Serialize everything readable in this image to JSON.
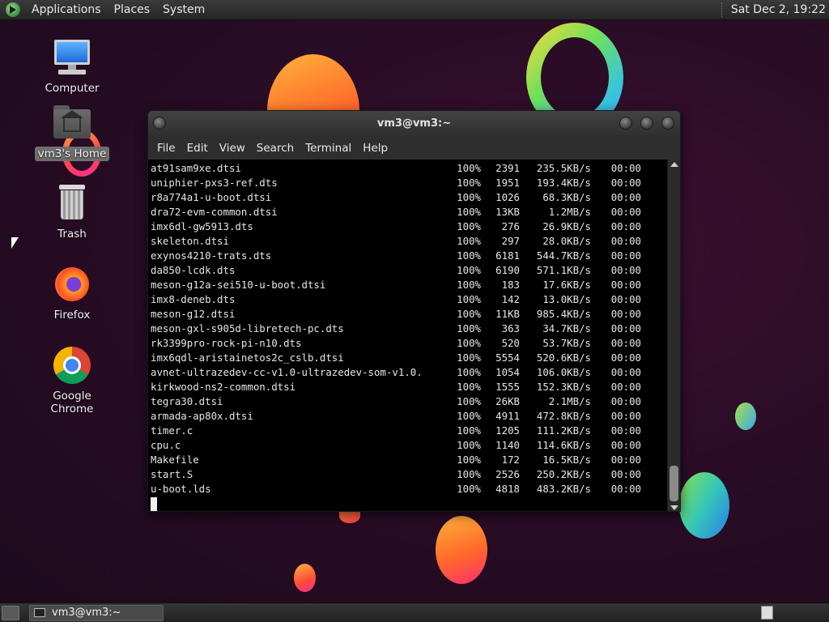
{
  "top_panel": {
    "menus": [
      "Applications",
      "Places",
      "System"
    ],
    "clock": "Sat Dec  2, 19:22"
  },
  "desktop": {
    "icons": [
      {
        "label": "Computer",
        "icon": "computer-icon"
      },
      {
        "label": "vm3's Home",
        "icon": "home-folder-icon"
      },
      {
        "label": "Trash",
        "icon": "trash-icon"
      },
      {
        "label": "Firefox",
        "icon": "firefox-icon"
      },
      {
        "label": "Google Chrome",
        "icon": "chrome-icon"
      }
    ]
  },
  "terminal": {
    "title": "vm3@vm3:~",
    "menus": [
      "File",
      "Edit",
      "View",
      "Search",
      "Terminal",
      "Help"
    ],
    "lines": [
      {
        "name": "at91sam9xe.dtsi",
        "pct": "100%",
        "size": "2391",
        "rate": "235.5KB/s",
        "time": "00:00"
      },
      {
        "name": "uniphier-pxs3-ref.dts",
        "pct": "100%",
        "size": "1951",
        "rate": "193.4KB/s",
        "time": "00:00"
      },
      {
        "name": "r8a774a1-u-boot.dtsi",
        "pct": "100%",
        "size": "1026",
        "rate": "68.3KB/s",
        "time": "00:00"
      },
      {
        "name": "dra72-evm-common.dtsi",
        "pct": "100%",
        "size": "13KB",
        "rate": "1.2MB/s",
        "time": "00:00"
      },
      {
        "name": "imx6dl-gw5913.dts",
        "pct": "100%",
        "size": "276",
        "rate": "26.9KB/s",
        "time": "00:00"
      },
      {
        "name": "skeleton.dtsi",
        "pct": "100%",
        "size": "297",
        "rate": "28.0KB/s",
        "time": "00:00"
      },
      {
        "name": "exynos4210-trats.dts",
        "pct": "100%",
        "size": "6181",
        "rate": "544.7KB/s",
        "time": "00:00"
      },
      {
        "name": "da850-lcdk.dts",
        "pct": "100%",
        "size": "6190",
        "rate": "571.1KB/s",
        "time": "00:00"
      },
      {
        "name": "meson-g12a-sei510-u-boot.dtsi",
        "pct": "100%",
        "size": "183",
        "rate": "17.6KB/s",
        "time": "00:00"
      },
      {
        "name": "imx8-deneb.dts",
        "pct": "100%",
        "size": "142",
        "rate": "13.0KB/s",
        "time": "00:00"
      },
      {
        "name": "meson-g12.dtsi",
        "pct": "100%",
        "size": "11KB",
        "rate": "985.4KB/s",
        "time": "00:00"
      },
      {
        "name": "meson-gxl-s905d-libretech-pc.dts",
        "pct": "100%",
        "size": "363",
        "rate": "34.7KB/s",
        "time": "00:00"
      },
      {
        "name": "rk3399pro-rock-pi-n10.dts",
        "pct": "100%",
        "size": "520",
        "rate": "53.7KB/s",
        "time": "00:00"
      },
      {
        "name": "imx6qdl-aristainetos2c_cslb.dtsi",
        "pct": "100%",
        "size": "5554",
        "rate": "520.6KB/s",
        "time": "00:00"
      },
      {
        "name": "avnet-ultrazedev-cc-v1.0-ultrazedev-som-v1.0.",
        "pct": "100%",
        "size": "1054",
        "rate": "106.0KB/s",
        "time": "00:00"
      },
      {
        "name": "kirkwood-ns2-common.dtsi",
        "pct": "100%",
        "size": "1555",
        "rate": "152.3KB/s",
        "time": "00:00"
      },
      {
        "name": "tegra30.dtsi",
        "pct": "100%",
        "size": "26KB",
        "rate": "2.1MB/s",
        "time": "00:00"
      },
      {
        "name": "armada-ap80x.dtsi",
        "pct": "100%",
        "size": "4911",
        "rate": "472.8KB/s",
        "time": "00:00"
      },
      {
        "name": "timer.c",
        "pct": "100%",
        "size": "1205",
        "rate": "111.2KB/s",
        "time": "00:00"
      },
      {
        "name": "cpu.c",
        "pct": "100%",
        "size": "1140",
        "rate": "114.6KB/s",
        "time": "00:00"
      },
      {
        "name": "Makefile",
        "pct": "100%",
        "size": "172",
        "rate": "16.5KB/s",
        "time": "00:00"
      },
      {
        "name": "start.S",
        "pct": "100%",
        "size": "2526",
        "rate": "250.2KB/s",
        "time": "00:00"
      },
      {
        "name": "u-boot.lds",
        "pct": "100%",
        "size": "4818",
        "rate": "483.2KB/s",
        "time": "00:00"
      }
    ]
  },
  "bottom_panel": {
    "task_label": "vm3@vm3:~"
  }
}
